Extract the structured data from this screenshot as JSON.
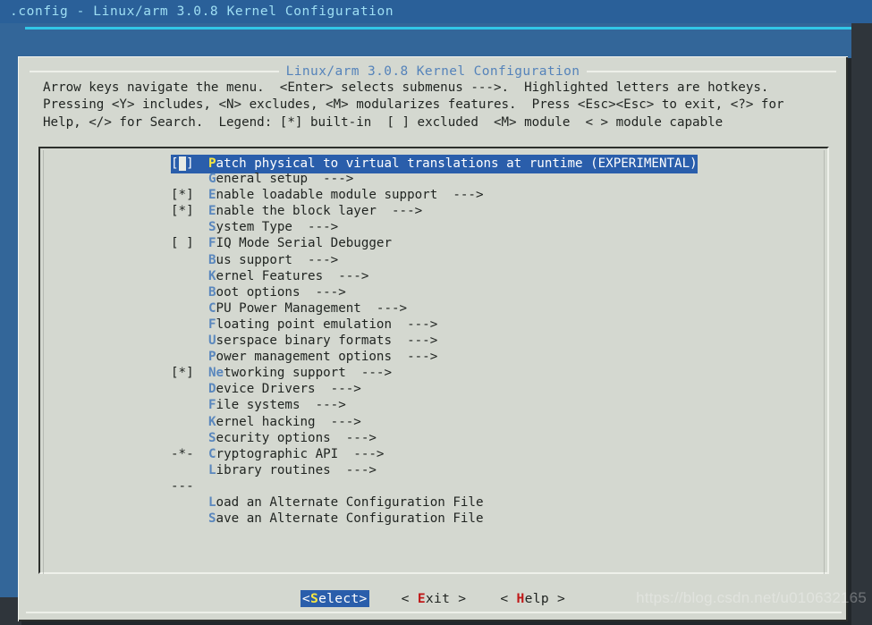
{
  "window": {
    "title": ".config - Linux/arm 3.0.8 Kernel Configuration"
  },
  "dialog": {
    "title": "Linux/arm 3.0.8 Kernel Configuration",
    "help_lines": [
      "Arrow keys navigate the menu.  <Enter> selects submenus --->.  Highlighted letters are hotkeys.",
      "Pressing <Y> includes, <N> excludes, <M> modularizes features.  Press <Esc><Esc> to exit, <?> for",
      "Help, </> for Search.  Legend: [*] built-in  [ ] excluded  <M> module  < > module capable"
    ]
  },
  "menu": {
    "items": [
      {
        "mark": "[ ]",
        "hot": "P",
        "rest": "atch physical to virtual translations at runtime (EXPERIMENTAL)",
        "arrow": "",
        "selected": true,
        "cursor": true
      },
      {
        "mark": "",
        "hot": "G",
        "rest": "eneral setup",
        "arrow": "  --->",
        "selected": false,
        "cursor": false
      },
      {
        "mark": "[*]",
        "hot": "E",
        "rest": "nable loadable module support",
        "arrow": "  --->",
        "selected": false,
        "cursor": false
      },
      {
        "mark": "[*]",
        "hot": "E",
        "rest": "nable the block layer",
        "arrow": "  --->",
        "selected": false,
        "cursor": false
      },
      {
        "mark": "",
        "hot": "S",
        "rest": "ystem Type",
        "arrow": "  --->",
        "selected": false,
        "cursor": false
      },
      {
        "mark": "[ ]",
        "hot": "F",
        "rest": "IQ Mode Serial Debugger",
        "arrow": "",
        "selected": false,
        "cursor": false
      },
      {
        "mark": "",
        "hot": "B",
        "rest": "us support",
        "arrow": "  --->",
        "selected": false,
        "cursor": false
      },
      {
        "mark": "",
        "hot": "K",
        "rest": "ernel Features",
        "arrow": "  --->",
        "selected": false,
        "cursor": false
      },
      {
        "mark": "",
        "hot": "B",
        "rest": "oot options",
        "arrow": "  --->",
        "selected": false,
        "cursor": false
      },
      {
        "mark": "",
        "hot": "C",
        "rest": "PU Power Management",
        "arrow": "  --->",
        "selected": false,
        "cursor": false
      },
      {
        "mark": "",
        "hot": "F",
        "rest": "loating point emulation",
        "arrow": "  --->",
        "selected": false,
        "cursor": false
      },
      {
        "mark": "",
        "hot": "U",
        "rest": "serspace binary formats",
        "arrow": "  --->",
        "selected": false,
        "cursor": false
      },
      {
        "mark": "",
        "hot": "P",
        "rest": "ower management options",
        "arrow": "  --->",
        "selected": false,
        "cursor": false
      },
      {
        "mark": "[*]",
        "hot": "Ne",
        "rest": "tworking support",
        "arrow": "  --->",
        "selected": false,
        "cursor": false
      },
      {
        "mark": "",
        "hot": "D",
        "rest": "evice Drivers",
        "arrow": "  --->",
        "selected": false,
        "cursor": false
      },
      {
        "mark": "",
        "hot": "F",
        "rest": "ile systems",
        "arrow": "  --->",
        "selected": false,
        "cursor": false
      },
      {
        "mark": "",
        "hot": "K",
        "rest": "ernel hacking",
        "arrow": "  --->",
        "selected": false,
        "cursor": false
      },
      {
        "mark": "",
        "hot": "S",
        "rest": "ecurity options",
        "arrow": "  --->",
        "selected": false,
        "cursor": false
      },
      {
        "mark": "-*-",
        "hot": "C",
        "rest": "ryptographic API",
        "arrow": "  --->",
        "selected": false,
        "cursor": false
      },
      {
        "mark": "",
        "hot": "L",
        "rest": "ibrary routines",
        "arrow": "  --->",
        "selected": false,
        "cursor": false
      },
      {
        "mark": "",
        "hot": "",
        "rest": "",
        "arrow": "",
        "selected": false,
        "cursor": false,
        "separator": "---"
      },
      {
        "mark": "",
        "hot": "L",
        "rest": "oad an Alternate Configuration File",
        "arrow": "",
        "selected": false,
        "cursor": false
      },
      {
        "mark": "",
        "hot": "S",
        "rest": "ave an Alternate Configuration File",
        "arrow": "",
        "selected": false,
        "cursor": false
      }
    ]
  },
  "buttons": [
    {
      "open": "<",
      "hot": "S",
      "rest": "elect",
      "close": ">",
      "active": true
    },
    {
      "open": "< ",
      "hot": "E",
      "rest": "xit",
      "close": " >",
      "active": false
    },
    {
      "open": "< ",
      "hot": "H",
      "rest": "elp",
      "close": " >",
      "active": false
    }
  ],
  "watermark": "https://blog.csdn.net/u010632165",
  "colors": {
    "titlebar_bg": "#2a6099",
    "titlebar_fg": "#9fdff4",
    "desktop_blue": "#336699",
    "dialog_bg": "#d4d8d0",
    "text": "#1f2320",
    "hotkey": "#5a87bd",
    "selection_bg": "#2a5eab",
    "selection_fg": "#ffffff",
    "selection_hotkey": "#f5e642",
    "button_hotkey": "#c01818",
    "dialog_title": "#5583ba"
  }
}
